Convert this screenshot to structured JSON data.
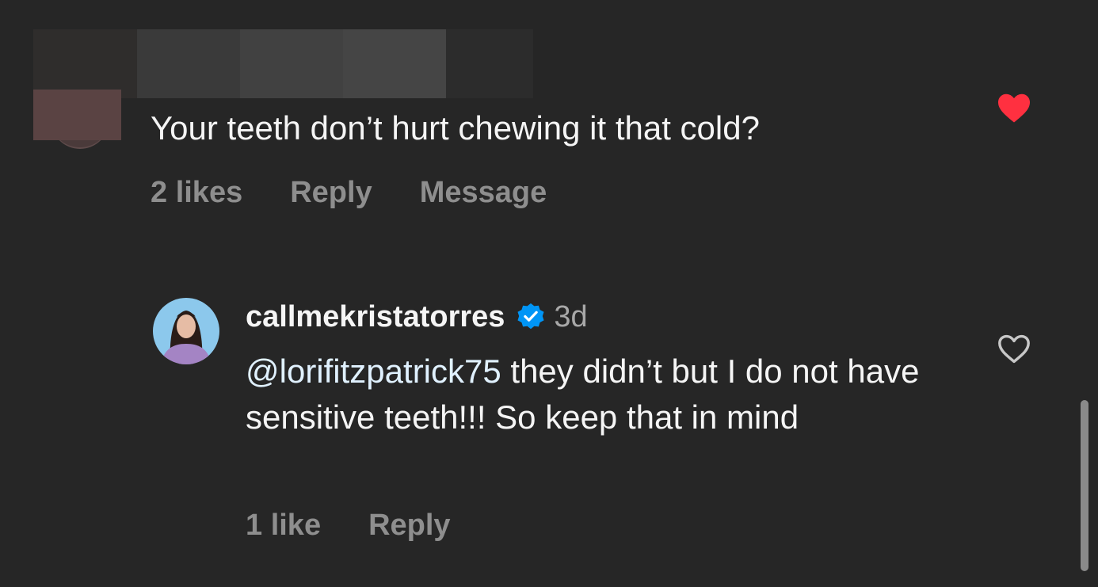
{
  "comment": {
    "text": "Your teeth don’t hurt chewing it that cold?",
    "likes": "2 likes",
    "reply_label": "Reply",
    "message_label": "Message",
    "liked": true
  },
  "reply": {
    "username": "callmekristatorres",
    "verified": true,
    "timestamp": "3d",
    "mention": "@lorifitzpatrick75",
    "text": " they didn’t but I do not have sensitive teeth!!! So keep that in mind",
    "likes": "1 like",
    "reply_label": "Reply",
    "liked": false
  },
  "icons": {
    "liked": "heart-filled-icon",
    "unliked": "heart-outline-icon",
    "verified": "verified-badge-icon"
  },
  "colors": {
    "background": "#262626",
    "like_red": "#ff3040",
    "verified_blue": "#0095f6",
    "muted_text": "#8e8e8e",
    "mention_text": "#e0f1ff"
  }
}
